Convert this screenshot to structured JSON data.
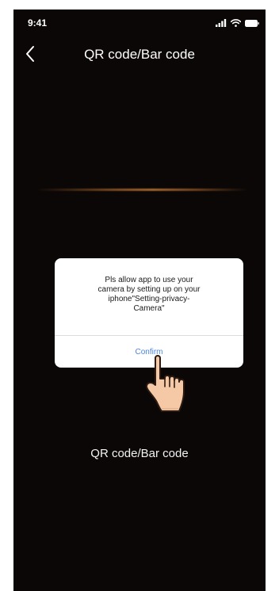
{
  "status_bar": {
    "time": "9:41",
    "icons": [
      "signal-icon",
      "wifi-icon",
      "battery-icon"
    ]
  },
  "nav": {
    "back_icon": "chevron-left-icon",
    "title": "QR code/Bar code"
  },
  "scanner": {
    "hint": "QR code/Bar code",
    "scan_line_color": "#a86a32"
  },
  "dialog": {
    "message_lines": [
      "Pls allow app to use your",
      "camera by setting up on your",
      "iphone\"Setting-privacy-",
      "Camera\""
    ],
    "confirm_label": "Confirm",
    "confirm_color": "#4a86e0"
  },
  "overlay": {
    "pointer_icon": "hand-pointer-icon"
  },
  "colors": {
    "background": "#0b0706",
    "text": "#ffffff",
    "dialog_bg": "#ffffff"
  }
}
